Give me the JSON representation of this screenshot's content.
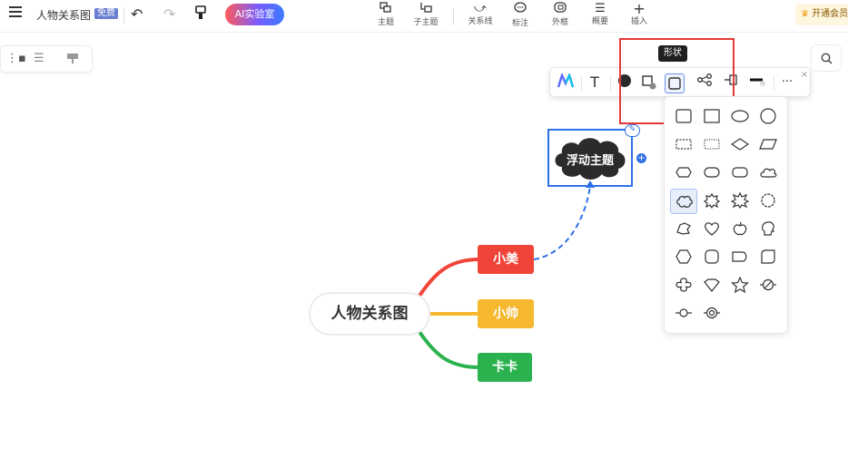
{
  "app": {
    "doc_title": "人物关系图",
    "badge": "免费",
    "ai_button": "AI实验室",
    "vip": "开通会员"
  },
  "toolbar": {
    "tools": [
      {
        "label": "主题",
        "icon": "topic-icon"
      },
      {
        "label": "子主题",
        "icon": "subtopic-icon"
      },
      {
        "label": "关系线",
        "icon": "relation-line-icon"
      },
      {
        "label": "标注",
        "icon": "callout-icon"
      },
      {
        "label": "外框",
        "icon": "boundary-icon"
      },
      {
        "label": "概要",
        "icon": "summary-icon"
      },
      {
        "label": "插入",
        "icon": "plus-icon"
      }
    ]
  },
  "float_toolbar": {
    "tooltip": "形状",
    "text_tool": "T",
    "more": "···"
  },
  "mindmap": {
    "root": "人物关系图",
    "branches": [
      {
        "label": "小美",
        "color": "#f04438"
      },
      {
        "label": "小帅",
        "color": "#f5b82e"
      },
      {
        "label": "卡卡",
        "color": "#2ab24e"
      }
    ],
    "floating_topic": "浮动主题"
  },
  "shape_panel": {
    "shapes": [
      "rounded-rect",
      "rect",
      "ellipse",
      "circle",
      "dashed-rect",
      "dotted-rect",
      "diamond",
      "parallelogram",
      "octagon-flat",
      "stadium",
      "rounded-stadium",
      "cloud",
      "cloud-burst",
      "starburst-small",
      "starburst",
      "burst-round",
      "scribble",
      "heart",
      "apple",
      "head",
      "hexagon",
      "rounded-square",
      "tag",
      "rounded-corner-square",
      "clover",
      "shield",
      "star",
      "null-circle",
      "line-circle",
      "target"
    ],
    "selected": "cloud-burst"
  }
}
